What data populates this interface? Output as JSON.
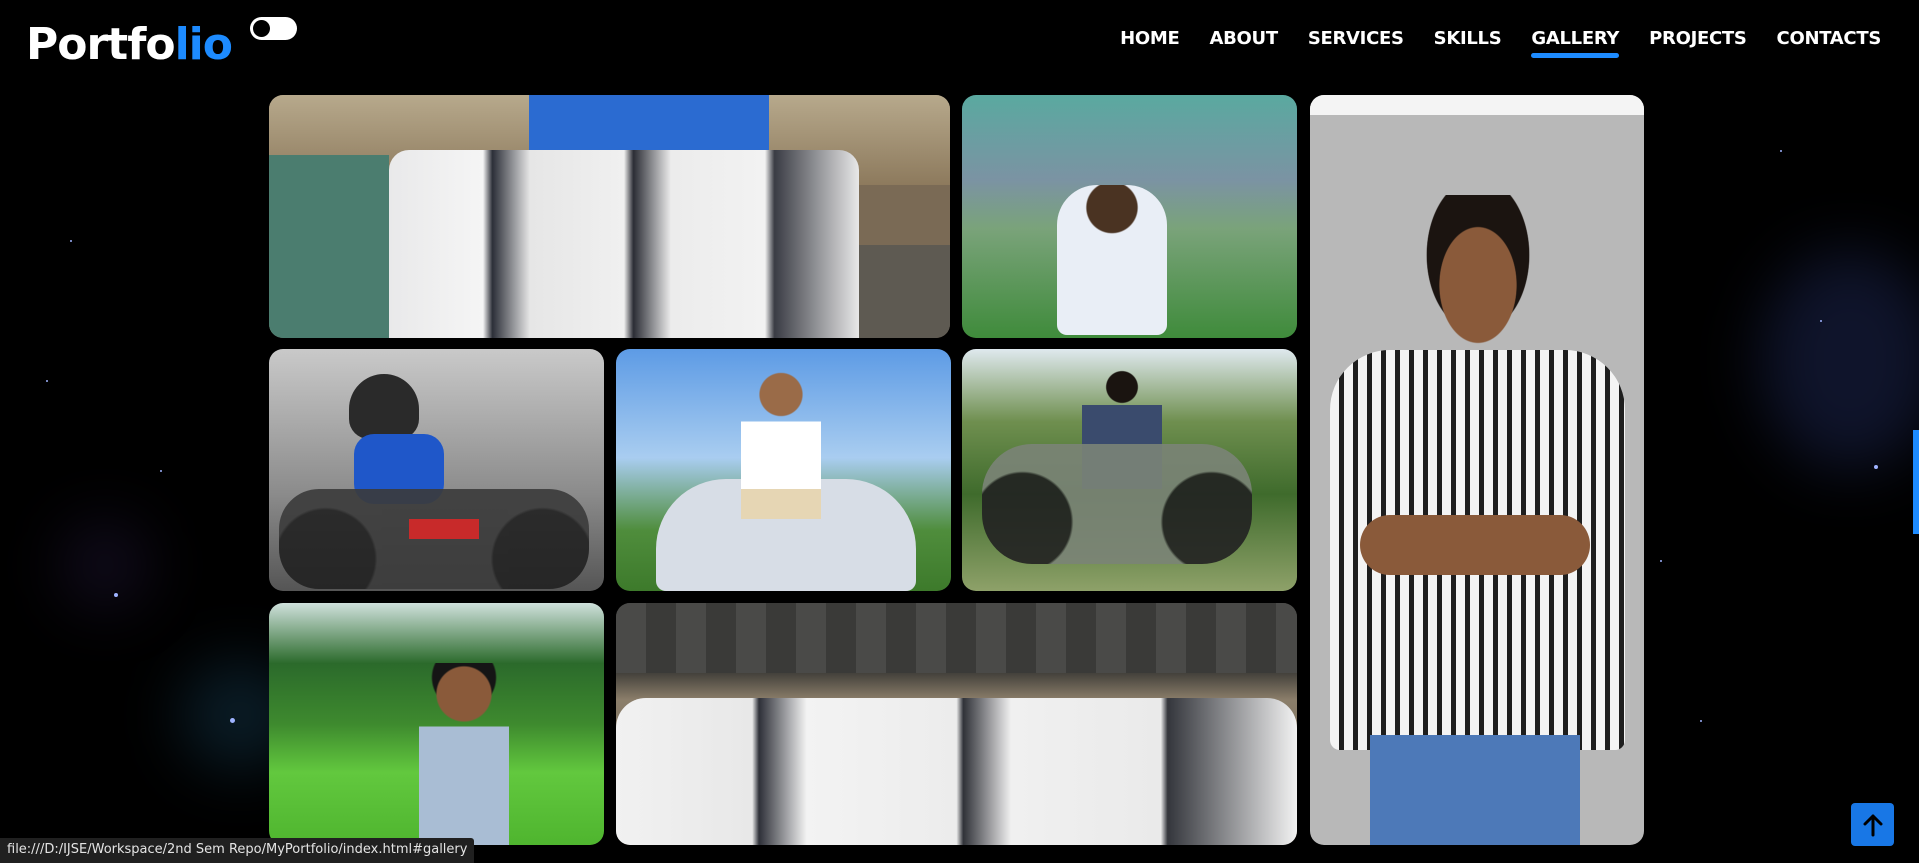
{
  "header": {
    "logo_main": "Portfo",
    "logo_accent": "lio",
    "nav": [
      "HOME",
      "ABOUT",
      "SERVICES",
      "SKILLS",
      "GALLERY",
      "PROJECTS",
      "CONTACTS"
    ],
    "active_nav": "GALLERY"
  },
  "gallery": {
    "photos": [
      {
        "name": "group-photo-factory",
        "alt": "group photo in warehouse"
      },
      {
        "name": "person-sitting-grass",
        "alt": "person sitting on grassy hill"
      },
      {
        "name": "person-standing-wall",
        "alt": "person standing in striped shirt"
      },
      {
        "name": "rider-with-helmet",
        "alt": "rider with helmet on motorbike"
      },
      {
        "name": "person-on-car",
        "alt": "person sitting on white car"
      },
      {
        "name": "person-on-classic-bike",
        "alt": "person on classic motorbike"
      },
      {
        "name": "person-paddy-field",
        "alt": "person in paddy field"
      },
      {
        "name": "group-photo-shed",
        "alt": "group photo under shed"
      }
    ]
  },
  "status_url": "file:///D:/IJSE/Workspace/2nd Sem Repo/MyPortfolio/index.html#gallery",
  "icons": {
    "scroll_top": "arrow-up-icon",
    "theme_toggle": "toggle-icon"
  },
  "colors": {
    "accent": "#1d8bff",
    "background": "#000000"
  }
}
